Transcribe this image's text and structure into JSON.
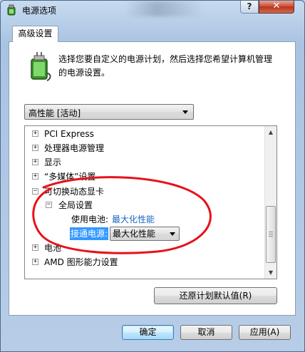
{
  "window": {
    "title": "电源选项",
    "help_label": "?",
    "close_label": "✕"
  },
  "tab": {
    "label": "高级设置"
  },
  "description": "选择您要自定义的电源计划，然后选择您希望计算机管理的电源设置。",
  "plan_select": {
    "value": "高性能 [活动]"
  },
  "tree": {
    "items": [
      {
        "expander": "+",
        "label": "PCI Express"
      },
      {
        "expander": "+",
        "label": "处理器电源管理"
      },
      {
        "expander": "+",
        "label": "显示"
      },
      {
        "expander": "+",
        "label": "“多媒体”设置"
      },
      {
        "expander": "−",
        "label": "可切换动态显卡"
      },
      {
        "expander": "−",
        "label": "全局设置"
      },
      {
        "expander": "+",
        "label": "电池"
      },
      {
        "expander": "+",
        "label": "AMD 图形能力设置"
      }
    ],
    "battery_label": "使用电池:",
    "battery_value": "最大化性能",
    "plugged_label": "接通电源:",
    "plugged_value": "最大化性能"
  },
  "buttons": {
    "restore": "还原计划默认值(R)",
    "ok": "确定",
    "cancel": "取消",
    "apply": "应用(A)"
  },
  "colors": {
    "highlight": "#3399ff",
    "link_value": "#1a64c4",
    "annotation": "#e8101a"
  },
  "icons": {
    "title": "power-plan-icon",
    "plan": "battery-plug-icon"
  }
}
